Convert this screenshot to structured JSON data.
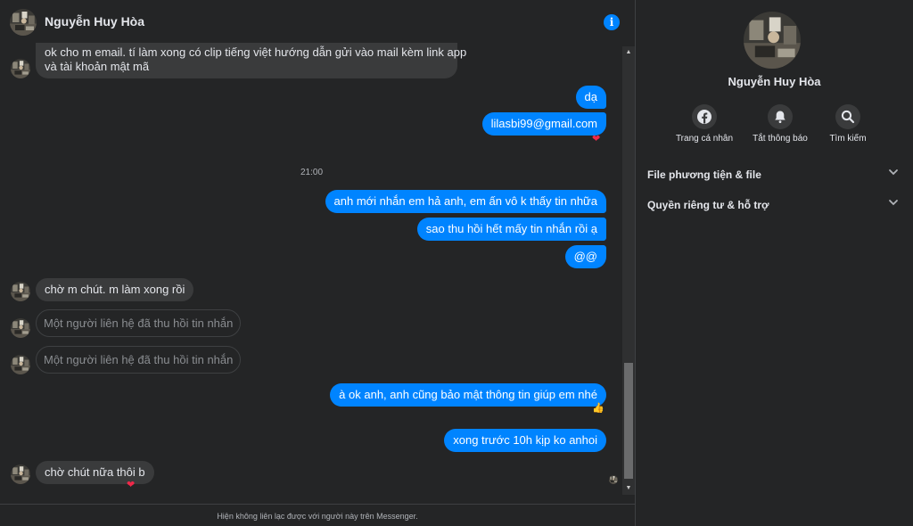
{
  "contact": {
    "name": "Nguyễn Huy Hòa"
  },
  "header": {
    "info_icon": "i"
  },
  "messages": [
    {
      "side": "in",
      "lines": [
        "ok cho m email. tí làm xong có clip tiếng việt hướng dẫn gửi vào mail kèm link app",
        "và tài khoản mật mã"
      ]
    },
    {
      "side": "out",
      "text": "dạ"
    },
    {
      "side": "out",
      "text": "lilasbi99@gmail.com",
      "reaction": "❤"
    },
    {
      "side": "out",
      "text": "anh mới nhắn em hả anh, em ấn vô k thấy tin nhữa"
    },
    {
      "side": "out",
      "text": "sao thu hồi hết mấy tin nhắn rồi ạ"
    },
    {
      "side": "out",
      "text": "@@"
    },
    {
      "side": "in",
      "text": "chờ m chút. m làm xong rồi"
    },
    {
      "side": "in",
      "text": "Một người liên hệ đã thu hồi tin nhắn",
      "recalled": true
    },
    {
      "side": "in",
      "text": "Một người liên hệ đã thu hồi tin nhắn",
      "recalled": true
    },
    {
      "side": "out",
      "text": "à ok anh, anh cũng bảo mật thông tin giúp em nhé",
      "reaction": "👍"
    },
    {
      "side": "out",
      "text": "xong trước 10h kịp ko anhoi"
    },
    {
      "side": "in",
      "text": "chờ chút nữa thôi b",
      "reaction": "❤"
    }
  ],
  "time_separator": "21:00",
  "footer": {
    "notice": "Hiện không liên lạc được với người này trên Messenger."
  },
  "sidebar": {
    "actions": [
      {
        "label": "Trang cá nhân",
        "icon": "facebook-icon"
      },
      {
        "label": "Tắt thông báo",
        "icon": "bell-icon"
      },
      {
        "label": "Tìm kiếm",
        "icon": "search-icon"
      }
    ],
    "sections": [
      {
        "label": "File phương tiện & file"
      },
      {
        "label": "Quyền riêng tư & hỗ trợ"
      }
    ]
  },
  "colors": {
    "background": "#242526",
    "incoming_bubble": "#3a3b3c",
    "outgoing_bubble": "#0084ff",
    "text": "#e4e6eb",
    "reaction_heart": "#f02849"
  }
}
